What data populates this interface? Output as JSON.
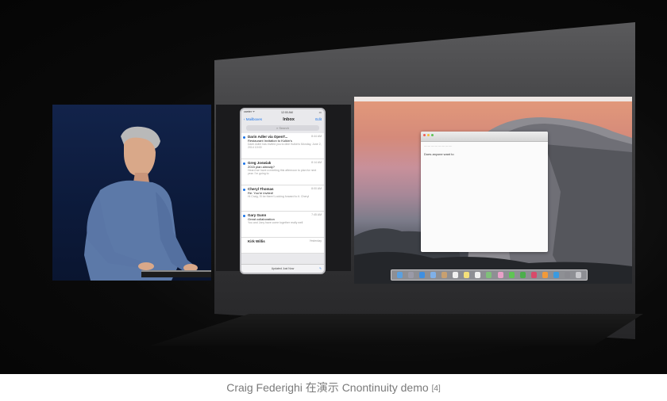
{
  "photo": {
    "description_icon": "keynote-stage-photo"
  },
  "phone": {
    "status_left": "carrier ᯤ",
    "status_time": "12:00 AM",
    "nav_back": "Mailboxes",
    "nav_title": "Inbox",
    "nav_edit": "Edit",
    "search_placeholder": "Search",
    "mails": [
      {
        "from": "Darin Adler via OpenT...",
        "time": "8:44 AM",
        "subject": "Restaurant Invitation to Kulkin's",
        "preview": "Darin Adler has invited you to dine Kulkin's Monday, June 2, 2014 10:00"
      },
      {
        "from": "Greg Joswiak",
        "time": "8:14 AM",
        "subject": "2015 plan already?",
        "preview": "Heard we have a meeting this afternoon to plan for next year. I'm going to"
      },
      {
        "from": "Cheryl Thomas",
        "time": "8:00 AM",
        "subject": "Re: You're invited!",
        "preview": "Hi Craig, I'll be there! Looking forward to it. Cheryl"
      },
      {
        "from": "Gary Gunn",
        "time": "7:45 AM",
        "subject": "Great collaboration",
        "preview": "You and Jony have come together really well"
      },
      {
        "from": "Kirk Willis",
        "time": "Yesterday",
        "subject": "",
        "preview": ""
      }
    ],
    "bottom_status": "Updated Just Now"
  },
  "mac": {
    "mail_body": "Does anyone want to"
  },
  "caption": {
    "text": "Craig Federighi 在演示 Cnontinuity demo",
    "ref": "[4]"
  }
}
